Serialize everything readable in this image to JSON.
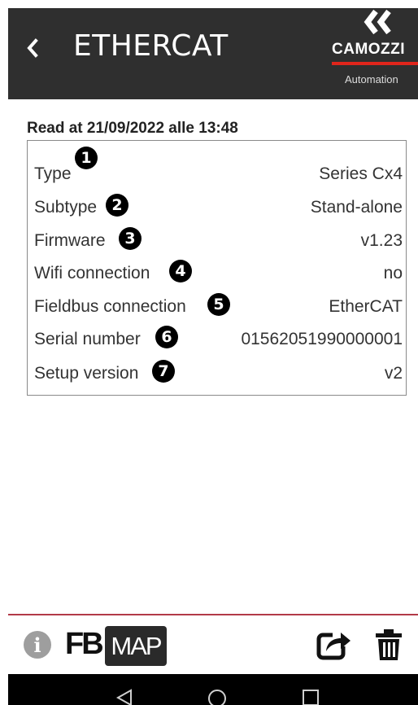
{
  "header": {
    "title": "ETHERCAT",
    "back_icon": "chevron-left-icon",
    "logo": {
      "wordmark": "CAMOZZI",
      "tagline": "Automation",
      "accent_color": "#e0251b"
    }
  },
  "read_at": "Read at 21/09/2022 alle 13:48",
  "rows": [
    {
      "label": "Type",
      "badge": "1",
      "value": "Series Cx4"
    },
    {
      "label": "Subtype",
      "badge": "2",
      "value": "Stand-alone"
    },
    {
      "label": "Firmware",
      "badge": "3",
      "value": "v1.23"
    },
    {
      "label": "Wifi connection",
      "badge": "4",
      "value": "no"
    },
    {
      "label": "Fieldbus connection",
      "badge": "5",
      "value": "EtherCAT"
    },
    {
      "label": "Serial number",
      "badge": "6",
      "value": "01562051990000001"
    },
    {
      "label": "Setup version",
      "badge": "7",
      "value": "v2"
    }
  ],
  "toolbar": {
    "info_icon": "i",
    "fb_label": "FB",
    "map_label": "MAP",
    "share_icon": "share-icon",
    "trash_icon": "trash-icon"
  },
  "colors": {
    "header_bg": "#2f2f2f",
    "divider": "#b23a48"
  }
}
